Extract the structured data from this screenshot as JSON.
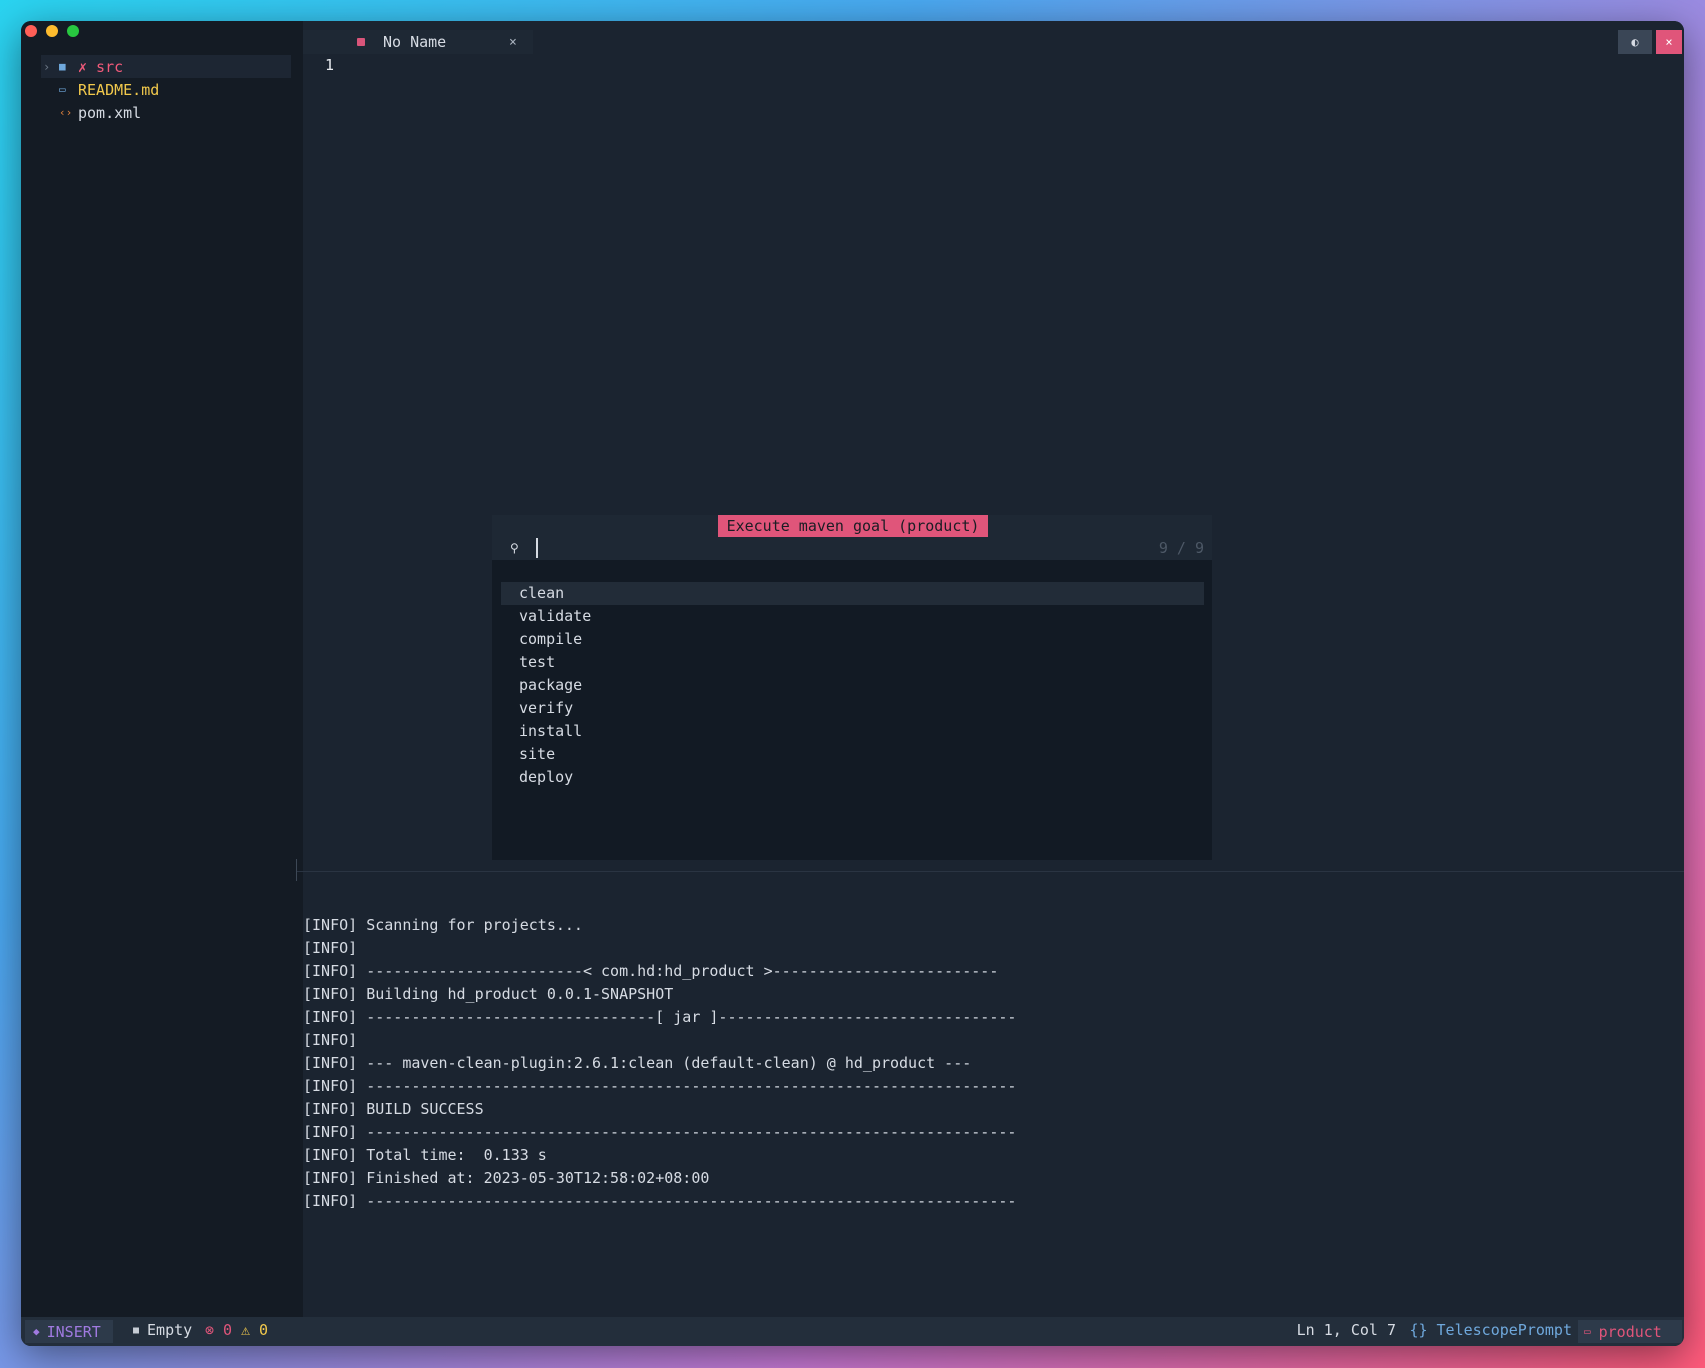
{
  "window": {
    "traffic_lights": [
      "close",
      "minimize",
      "zoom"
    ]
  },
  "sidebar": {
    "items": [
      {
        "chevron": "›",
        "icon": "folder-icon",
        "glyph": "■",
        "label": "✗ src"
      },
      {
        "icon": "markdown-icon",
        "glyph": "▭",
        "label": "README.md"
      },
      {
        "icon": "xml-icon",
        "glyph": "‹›",
        "label": "pom.xml"
      }
    ]
  },
  "editor": {
    "tab_title": "No Name",
    "tab_close": "×",
    "line_number": "1",
    "toggle_glyph": "◐",
    "close_glyph": "×"
  },
  "telescope": {
    "title": "Execute maven goal (product)",
    "search_glyph": "⚲",
    "count": "9 / 9",
    "items": [
      "clean",
      "validate",
      "compile",
      "test",
      "package",
      "verify",
      "install",
      "site",
      "deploy"
    ]
  },
  "terminal": {
    "lines": [
      "[INFO] Scanning for projects...",
      "[INFO]",
      "[INFO] ------------------------< com.hd:hd_product >-------------------------",
      "[INFO] Building hd_product 0.0.1-SNAPSHOT",
      "[INFO] --------------------------------[ jar ]---------------------------------",
      "[INFO]",
      "[INFO] --- maven-clean-plugin:2.6.1:clean (default-clean) @ hd_product ---",
      "[INFO] ------------------------------------------------------------------------",
      "[INFO] BUILD SUCCESS",
      "[INFO] ------------------------------------------------------------------------",
      "[INFO] Total time:  0.133 s",
      "[INFO] Finished at: 2023-05-30T12:58:02+08:00",
      "[INFO] ------------------------------------------------------------------------"
    ]
  },
  "statusbar": {
    "mode_glyph": "◆",
    "mode": "INSERT",
    "file_glyph": "■",
    "file": "Empty",
    "errors": "⊗ 0",
    "warnings": "⚠ 0",
    "position": "Ln 1, Col 7",
    "filetype": "{} TelescopePrompt",
    "branch_glyph": "▭",
    "branch": "product"
  },
  "colors": {
    "accent": "#e0557a",
    "background": "#1b2430",
    "sidebar": "#141b24",
    "mode": "#a07ae0",
    "filetype": "#6fa8dc",
    "warning": "#f2c94c"
  }
}
